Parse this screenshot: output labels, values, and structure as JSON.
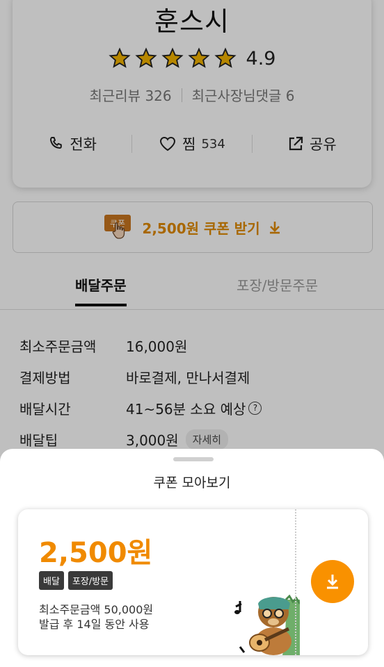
{
  "store": {
    "name": "훈스시",
    "rating": "4.9",
    "stars": 5,
    "recent_reviews": "최근리뷰 326",
    "owner_replies": "최근사장님댓글 6"
  },
  "actions": {
    "call": "전화",
    "like": "찜",
    "like_count": "534",
    "share": "공유"
  },
  "coupon_button": {
    "badge": "쿠폰",
    "label": "2,500원 쿠폰 받기"
  },
  "tabs": {
    "delivery": "배달주문",
    "pickup": "포장/방문주문"
  },
  "info": {
    "min_order_label": "최소주문금액",
    "min_order_value": "16,000원",
    "payment_label": "결제방법",
    "payment_value": "바로결제, 만나서결제",
    "time_label": "배달시간",
    "time_value": "41~56분 소요 예상",
    "tip_label": "배달팁",
    "tip_value": "3,000원",
    "tip_detail": "자세히"
  },
  "sheet": {
    "title": "쿠폰 모아보기",
    "coupon": {
      "amount": "2,500원",
      "tags": [
        "배달",
        "포장/방문"
      ],
      "min_order": "최소주문금액 50,000원",
      "validity": "발급 후 14일 동안 사용"
    }
  },
  "colors": {
    "accent": "#f99100",
    "amount_text": "#f08a00",
    "star": "#f5b400"
  }
}
